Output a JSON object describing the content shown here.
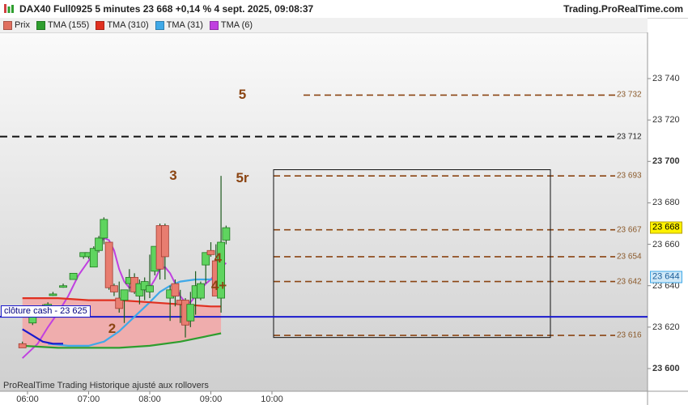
{
  "header": {
    "title": "DAX40 Full0925 5 minutes 23 668 +0,14 % 4 sept. 2025, 09:08:37",
    "brand": "Trading.ProRealTime.com"
  },
  "legend": [
    {
      "label": "Prix",
      "color": "#e07060"
    },
    {
      "label": "TMA (155)",
      "color": "#2e9e2e"
    },
    {
      "label": "TMA (310)",
      "color": "#e03020"
    },
    {
      "label": "TMA (31)",
      "color": "#3fa9e8"
    },
    {
      "label": "TMA (6)",
      "color": "#c040e0"
    }
  ],
  "footer_note": "ProRealTime Trading  Historique ajusté aux rollovers",
  "cash_close": {
    "label": "clôture cash -  23 625",
    "value": 23625
  },
  "price_tags": [
    {
      "text": "23 668",
      "value": 23668,
      "bg": "#fff200",
      "fg": "#000000",
      "border": "#b5a000"
    },
    {
      "text": "23 644",
      "value": 23644,
      "bg": "#cfe8f7",
      "fg": "#1a5e9a",
      "border": "#3fa9e8"
    }
  ],
  "levels": [
    {
      "text": "23 732",
      "value": 23732,
      "style": "brown"
    },
    {
      "text": "23 712",
      "value": 23712,
      "style": "black"
    },
    {
      "text": "23 693",
      "value": 23693,
      "style": "brown"
    },
    {
      "text": "23 667",
      "value": 23667,
      "style": "brown"
    },
    {
      "text": "23 654",
      "value": 23654,
      "style": "brown"
    },
    {
      "text": "23 642",
      "value": 23642,
      "style": "brown"
    },
    {
      "text": "23 616",
      "value": 23616,
      "style": "brown"
    }
  ],
  "wave_labels": [
    {
      "text": "5",
      "time": "09:31",
      "value": 23732
    },
    {
      "text": "3",
      "time": "08:23",
      "value": 23693
    },
    {
      "text": "5r",
      "time": "09:31",
      "value": 23692
    },
    {
      "text": "4",
      "time": "09:07",
      "value": 23653
    },
    {
      "text": "4+",
      "time": "09:08",
      "value": 23640
    },
    {
      "text": "2",
      "time": "07:23",
      "value": 23619
    }
  ],
  "chart_data": {
    "type": "candlestick",
    "timeframe": "5 minutes",
    "x_ticks": [
      "06:00",
      "07:00",
      "08:00",
      "09:00",
      "10:00"
    ],
    "y_ticks": [
      {
        "label": "23 740",
        "value": 23740,
        "bold": false
      },
      {
        "label": "23 720",
        "value": 23720,
        "bold": false
      },
      {
        "label": "23 700",
        "value": 23700,
        "bold": true
      },
      {
        "label": "23 680",
        "value": 23680,
        "bold": false
      },
      {
        "label": "23 660",
        "value": 23660,
        "bold": false
      },
      {
        "label": "23 640",
        "value": 23640,
        "bold": false
      },
      {
        "label": "23 620",
        "value": 23620,
        "bold": false
      },
      {
        "label": "23 600",
        "value": 23600,
        "bold": true
      }
    ],
    "ylim": [
      23590,
      23756
    ],
    "candles": [
      {
        "t": "05:55",
        "o": 23612,
        "h": 23613,
        "l": 23610,
        "c": 23610
      },
      {
        "t": "06:05",
        "o": 23622,
        "h": 23627,
        "l": 23621,
        "c": 23626
      },
      {
        "t": "06:15",
        "o": 23629,
        "h": 23631,
        "l": 23628,
        "c": 23630
      },
      {
        "t": "06:20",
        "o": 23631,
        "h": 23632,
        "l": 23630,
        "c": 23631
      },
      {
        "t": "06:25",
        "o": 23636,
        "h": 23637,
        "l": 23635,
        "c": 23636
      },
      {
        "t": "06:35",
        "o": 23640,
        "h": 23641,
        "l": 23639,
        "c": 23640
      },
      {
        "t": "06:45",
        "o": 23643,
        "h": 23646,
        "l": 23643,
        "c": 23646
      },
      {
        "t": "06:55",
        "o": 23654,
        "h": 23656,
        "l": 23653,
        "c": 23656
      },
      {
        "t": "07:00",
        "o": 23654,
        "h": 23656,
        "l": 23653,
        "c": 23656
      },
      {
        "t": "07:05",
        "o": 23649,
        "h": 23659,
        "l": 23649,
        "c": 23658
      },
      {
        "t": "07:10",
        "o": 23657,
        "h": 23664,
        "l": 23656,
        "c": 23663
      },
      {
        "t": "07:15",
        "o": 23663,
        "h": 23673,
        "l": 23660,
        "c": 23672
      },
      {
        "t": "07:20",
        "o": 23661,
        "h": 23661,
        "l": 23638,
        "c": 23639
      },
      {
        "t": "07:25",
        "o": 23640,
        "h": 23641,
        "l": 23635,
        "c": 23637
      },
      {
        "t": "07:30",
        "o": 23634,
        "h": 23642,
        "l": 23627,
        "c": 23629
      },
      {
        "t": "07:35",
        "o": 23633,
        "h": 23638,
        "l": 23622,
        "c": 23638
      },
      {
        "t": "07:40",
        "o": 23641,
        "h": 23648,
        "l": 23637,
        "c": 23644
      },
      {
        "t": "07:45",
        "o": 23644,
        "h": 23646,
        "l": 23636,
        "c": 23637
      },
      {
        "t": "07:50",
        "o": 23635,
        "h": 23643,
        "l": 23631,
        "c": 23641
      },
      {
        "t": "07:55",
        "o": 23638,
        "h": 23644,
        "l": 23633,
        "c": 23642
      },
      {
        "t": "08:00",
        "o": 23637,
        "h": 23655,
        "l": 23634,
        "c": 23640
      },
      {
        "t": "08:05",
        "o": 23647,
        "h": 23659,
        "l": 23645,
        "c": 23659
      },
      {
        "t": "08:10",
        "o": 23669,
        "h": 23670,
        "l": 23643,
        "c": 23648
      },
      {
        "t": "08:15",
        "o": 23669,
        "h": 23670,
        "l": 23643,
        "c": 23654
      },
      {
        "t": "08:20",
        "o": 23634,
        "h": 23640,
        "l": 23623,
        "c": 23638
      },
      {
        "t": "08:25",
        "o": 23641,
        "h": 23643,
        "l": 23630,
        "c": 23635
      },
      {
        "t": "08:30",
        "o": 23633,
        "h": 23638,
        "l": 23622,
        "c": 23631
      },
      {
        "t": "08:35",
        "o": 23633,
        "h": 23634,
        "l": 23615,
        "c": 23621
      },
      {
        "t": "08:40",
        "o": 23623,
        "h": 23637,
        "l": 23620,
        "c": 23631
      },
      {
        "t": "08:45",
        "o": 23634,
        "h": 23647,
        "l": 23626,
        "c": 23640
      },
      {
        "t": "08:50",
        "o": 23634,
        "h": 23642,
        "l": 23633,
        "c": 23641
      },
      {
        "t": "08:55",
        "o": 23650,
        "h": 23656,
        "l": 23641,
        "c": 23656
      },
      {
        "t": "09:00",
        "o": 23657,
        "h": 23661,
        "l": 23654,
        "c": 23655
      },
      {
        "t": "09:05",
        "o": 23652,
        "h": 23660,
        "l": 23639,
        "c": 23635
      },
      {
        "t": "09:10",
        "o": 23634,
        "h": 23693,
        "l": 23627,
        "c": 23661
      },
      {
        "t": "09:15",
        "o": 23662,
        "h": 23669,
        "l": 23660,
        "c": 23668
      }
    ],
    "series": [
      {
        "name": "TMA (6)",
        "color": "#c040e0",
        "points": [
          [
            "05:55",
            23605
          ],
          [
            "06:10",
            23612
          ],
          [
            "06:20",
            23620
          ],
          [
            "06:30",
            23627
          ],
          [
            "06:40",
            23635
          ],
          [
            "06:50",
            23645
          ],
          [
            "07:00",
            23652
          ],
          [
            "07:10",
            23660
          ],
          [
            "07:15",
            23663
          ],
          [
            "07:20",
            23662
          ],
          [
            "07:25",
            23657
          ],
          [
            "07:30",
            23648
          ],
          [
            "07:35",
            23642
          ],
          [
            "07:40",
            23639
          ],
          [
            "07:45",
            23640
          ],
          [
            "07:50",
            23639
          ],
          [
            "07:55",
            23638
          ],
          [
            "08:00",
            23639
          ],
          [
            "08:05",
            23643
          ],
          [
            "08:10",
            23648
          ],
          [
            "08:15",
            23649
          ],
          [
            "08:20",
            23646
          ],
          [
            "08:25",
            23641
          ],
          [
            "08:30",
            23635
          ],
          [
            "08:35",
            23632
          ],
          [
            "08:40",
            23632
          ],
          [
            "08:45",
            23635
          ],
          [
            "08:50",
            23638
          ],
          [
            "08:55",
            23641
          ],
          [
            "09:00",
            23643
          ],
          [
            "09:05",
            23646
          ],
          [
            "09:10",
            23649
          ],
          [
            "09:15",
            23651
          ]
        ]
      },
      {
        "name": "TMA (31)",
        "color": "#3fa9e8",
        "points": [
          [
            "06:20",
            23612
          ],
          [
            "06:40",
            23611
          ],
          [
            "07:00",
            23611
          ],
          [
            "07:15",
            23613
          ],
          [
            "07:30",
            23618
          ],
          [
            "07:45",
            23625
          ],
          [
            "08:00",
            23632
          ],
          [
            "08:10",
            23637
          ],
          [
            "08:20",
            23640
          ],
          [
            "08:30",
            23642
          ],
          [
            "08:45",
            23643
          ],
          [
            "09:00",
            23643
          ],
          [
            "09:10",
            23643
          ]
        ]
      },
      {
        "name": "TMA (310)",
        "color": "#e03020",
        "points": [
          [
            "05:55",
            23634
          ],
          [
            "06:30",
            23634
          ],
          [
            "07:00",
            23633
          ],
          [
            "07:30",
            23633
          ],
          [
            "08:00",
            23632
          ],
          [
            "08:30",
            23631
          ],
          [
            "09:00",
            23630
          ],
          [
            "09:10",
            23630
          ]
        ]
      },
      {
        "name": "TMA (155)",
        "color": "#2e9e2e",
        "points": [
          [
            "05:55",
            23611
          ],
          [
            "06:30",
            23610
          ],
          [
            "07:00",
            23610
          ],
          [
            "07:30",
            23610
          ],
          [
            "08:00",
            23611
          ],
          [
            "08:30",
            23613
          ],
          [
            "09:00",
            23616
          ],
          [
            "09:10",
            23617
          ]
        ]
      },
      {
        "name": "",
        "color": "#1a1acd",
        "points": [
          [
            "05:55",
            23619
          ],
          [
            "06:05",
            23616
          ],
          [
            "06:15",
            23613
          ],
          [
            "06:25",
            23612
          ],
          [
            "06:35",
            23612
          ]
        ]
      }
    ]
  }
}
